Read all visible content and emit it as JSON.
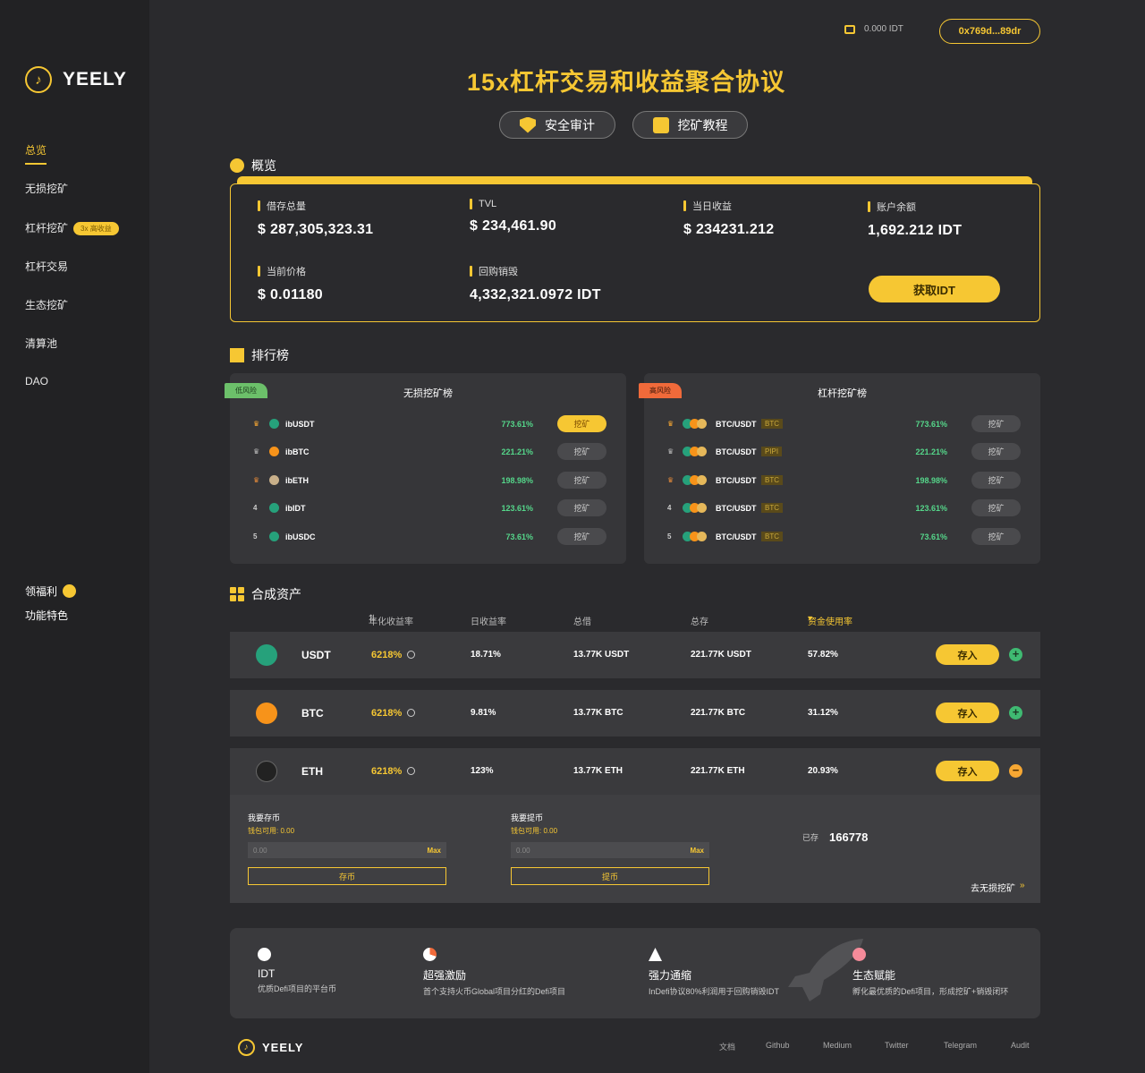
{
  "sidebar": {
    "logo": "YEELY",
    "items": [
      {
        "label": "总览",
        "active": true
      },
      {
        "label": "无损挖矿"
      },
      {
        "label": "杠杆挖矿",
        "badge": "3x 高收益"
      },
      {
        "label": "杠杆交易"
      },
      {
        "label": "生态挖矿"
      },
      {
        "label": "清算池"
      },
      {
        "label": "DAO"
      }
    ],
    "bottom": [
      "领福利",
      "功能特色"
    ]
  },
  "header": {
    "balance": "0.000 IDT",
    "address": "0x769d...89dr"
  },
  "hero": {
    "title": "15x杠杆交易和收益聚合协议",
    "btn_audit": "安全审计",
    "btn_tutorial": "挖矿教程"
  },
  "overview": {
    "title": "概览",
    "stats": [
      {
        "label": "借存总量",
        "value": "$ 287,305,323.31"
      },
      {
        "label": "TVL",
        "value": "$ 234,461.90"
      },
      {
        "label": "当日收益",
        "value": "$ 234231.212"
      },
      {
        "label": "账户余额",
        "value": "1,692.212  IDT"
      },
      {
        "label": "当前价格",
        "value": "$ 0.01180"
      },
      {
        "label": "回购销毁",
        "value": "4,332,321.0972 IDT"
      }
    ],
    "get_btn": "获取IDT"
  },
  "leaderboard": {
    "title": "排行榜",
    "left": {
      "tag": "低风险",
      "title": "无损挖矿榜",
      "rows": [
        {
          "rank": "",
          "name": "ibUSDT",
          "pct": "773.61%",
          "btn": "挖矿",
          "color": "#26a17b"
        },
        {
          "rank": "",
          "name": "ibBTC",
          "pct": "221.21%",
          "btn": "挖矿",
          "color": "#f7931a"
        },
        {
          "rank": "",
          "name": "ibETH",
          "pct": "198.98%",
          "btn": "挖矿",
          "color": "#c9b08a"
        },
        {
          "rank": "4",
          "name": "ibIDT",
          "pct": "123.61%",
          "btn": "挖矿",
          "color": "#26a17b"
        },
        {
          "rank": "5",
          "name": "ibUSDC",
          "pct": "73.61%",
          "btn": "挖矿",
          "color": "#26a17b"
        }
      ]
    },
    "right": {
      "tag": "高风险",
      "title": "杠杆挖矿榜",
      "rows": [
        {
          "rank": "",
          "name": "BTC/USDT",
          "tag": "BTC",
          "pct": "773.61%",
          "btn": "挖矿"
        },
        {
          "rank": "",
          "name": "BTC/USDT",
          "tag": "PIPI",
          "pct": "221.21%",
          "btn": "挖矿"
        },
        {
          "rank": "",
          "name": "BTC/USDT",
          "tag": "BTC",
          "pct": "198.98%",
          "btn": "挖矿"
        },
        {
          "rank": "4",
          "name": "BTC/USDT",
          "tag": "BTC",
          "pct": "123.61%",
          "btn": "挖矿"
        },
        {
          "rank": "5",
          "name": "BTC/USDT",
          "tag": "BTC",
          "pct": "73.61%",
          "btn": "挖矿"
        }
      ]
    }
  },
  "assets": {
    "title": "合成资产",
    "headers": [
      "年化收益率",
      "日收益率",
      "总借",
      "总存",
      "资金使用率"
    ],
    "rows": [
      {
        "symbol": "USDT",
        "apy": "6218%",
        "daily": "18.71%",
        "borrow": "13.77K USDT",
        "supply": "221.77K USDT",
        "util": "57.82%",
        "btn": "存入",
        "color": "#26a17b"
      },
      {
        "symbol": "BTC",
        "apy": "6218%",
        "daily": "9.81%",
        "borrow": "13.77K BTC",
        "supply": "221.77K BTC",
        "util": "31.12%",
        "btn": "存入",
        "color": "#f7931a"
      },
      {
        "symbol": "ETH",
        "apy": "6218%",
        "daily": "123%",
        "borrow": "13.77K ETH",
        "supply": "221.77K ETH",
        "util": "20.93%",
        "btn": "存入",
        "color": "#222"
      }
    ],
    "expand": {
      "deposit_title": "我要存币",
      "deposit_wallet": "钱包可用: 0.00",
      "deposit_placeholder": "0.00",
      "deposit_btn": "存币",
      "withdraw_title": "我要提币",
      "withdraw_wallet": "钱包可用: 0.00",
      "withdraw_placeholder": "0.00",
      "withdraw_btn": "提币",
      "max": "Max",
      "stored_label": "已存",
      "stored_value": "166778",
      "link": "去无损挖矿"
    }
  },
  "features": [
    {
      "title": "IDT",
      "desc": "优质Defi项目的平台币"
    },
    {
      "title": "超强激励",
      "desc": "首个支持火币Global项目分红的Defi项目"
    },
    {
      "title": "强力通缩",
      "desc": "InDefi协议80%利润用于回购销毁IDT"
    },
    {
      "title": "生态赋能",
      "desc": "孵化最优质的Defi项目，形成挖矿+销毁闭环"
    }
  ],
  "footer": {
    "logo": "YEELY",
    "links": [
      "文档",
      "Github",
      "Medium",
      "Twitter",
      "Telegram",
      "Audit"
    ]
  }
}
